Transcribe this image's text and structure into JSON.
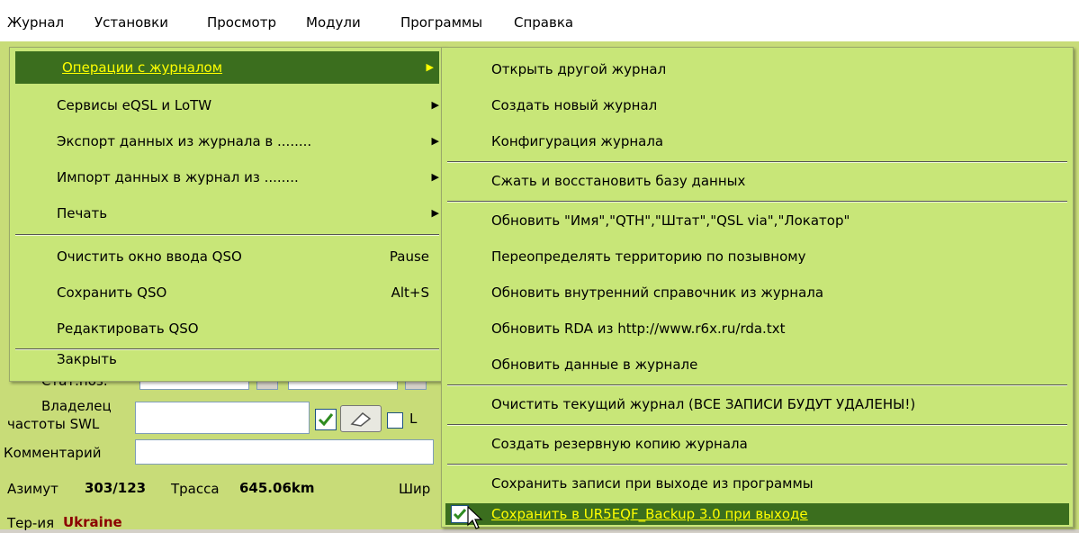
{
  "menubar": {
    "items": [
      "Журнал",
      "Установки",
      "Просмотр",
      "Модули",
      "Программы",
      "Справка"
    ]
  },
  "form": {
    "owner_label_1": "Владелец",
    "owner_label_2": "частоты SWL",
    "comment_label": "Комментарий",
    "azimuth_label": "Азимут",
    "azimuth_value": "303/123",
    "path_label": "Трасса",
    "path_value": "645.06km",
    "width_label": "Шир",
    "country_label": "Тер-ия",
    "country_value": "Ukraine",
    "partial_label": "Стат.поз.",
    "partial_letter": "L"
  },
  "menu1": {
    "items": [
      {
        "label": "Операции с журналом",
        "submenu": true,
        "highlighted": true
      },
      {
        "label": "Сервисы eQSL и LoTW",
        "submenu": true
      },
      {
        "label": "Экспорт данных из журнала в ........",
        "submenu": true
      },
      {
        "label": "Импорт данных в журнал из ........",
        "submenu": true
      },
      {
        "label": "Печать",
        "submenu": true
      },
      {
        "label": "Очистить окно ввода QSO",
        "shortcut": "Pause"
      },
      {
        "label": "Сохранить QSO",
        "shortcut": "Alt+S"
      },
      {
        "label": "Редактировать QSO"
      },
      {
        "label": "Закрыть"
      }
    ]
  },
  "menu2": {
    "items": [
      {
        "label": "Открыть другой журнал"
      },
      {
        "label": "Создать новый журнал"
      },
      {
        "label": "Конфигурация журнала"
      },
      {
        "label": "Сжать и восстановить базу данных"
      },
      {
        "label": "Обновить \"Имя\",\"QTH\",\"Штат\",\"QSL via\",\"Локатор\""
      },
      {
        "label": "Переопределять территорию по позывному"
      },
      {
        "label": "Обновить внутренний справочник из журнала"
      },
      {
        "label": "Обновить RDA из http://www.r6x.ru/rda.txt"
      },
      {
        "label": "Обновить данные в журнале"
      },
      {
        "label": "Очистить текущий журнал (ВСЕ ЗАПИСИ БУДУТ УДАЛЕНЫ!)"
      },
      {
        "label": "Создать резервную копию журнала"
      },
      {
        "label": "Сохранить записи при выходе из программы"
      },
      {
        "label": "Сохранить в UR5EQF_Backup 3.0 при выходе",
        "checked": true,
        "highlighted": true
      }
    ]
  },
  "colors": {
    "menu_bg": "#c8e678",
    "highlight_bg": "#3b6e1e",
    "highlight_text": "#ffff00",
    "country_text": "#8b0000"
  }
}
